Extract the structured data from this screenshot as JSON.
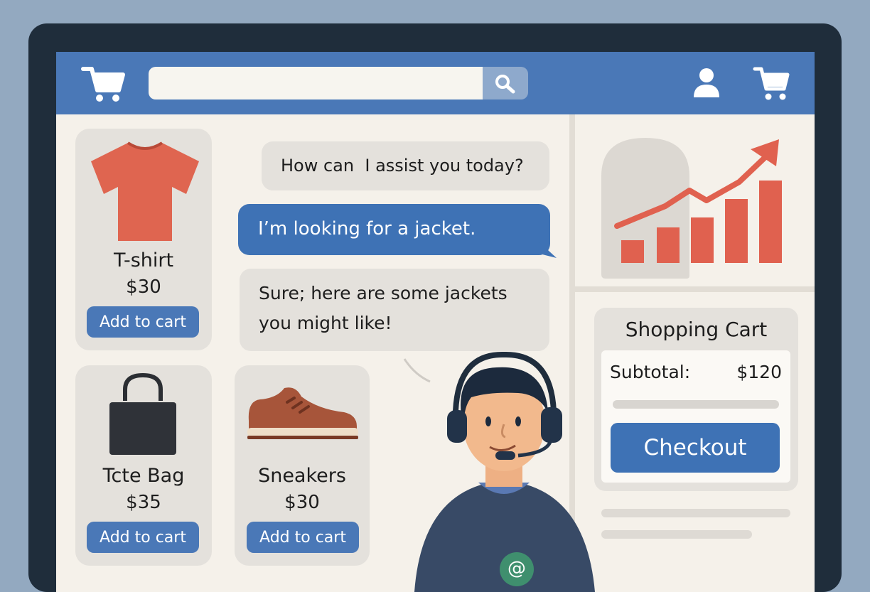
{
  "header": {
    "search": {
      "value": "",
      "placeholder": ""
    },
    "icons": [
      "cart-logo-icon",
      "search-icon",
      "user-icon",
      "cart-icon"
    ]
  },
  "products": [
    {
      "name": "T-shirt",
      "price": "$30",
      "button": "Add to cart",
      "icon": "t-shirt-icon"
    },
    {
      "name": "Tcte Bag",
      "price": "$35",
      "button": "Add to cart",
      "icon": "tote-bag-icon"
    },
    {
      "name": "Sneakers",
      "price": "$30",
      "button": "Add to cart",
      "icon": "sneaker-icon"
    }
  ],
  "chat": {
    "messages": [
      {
        "sender": "agent",
        "text": "How can  I assist you today?"
      },
      {
        "sender": "user",
        "text": "I’m looking for a jacket."
      },
      {
        "sender": "agent",
        "line1": "Sure; here are some jackets",
        "line2": "you might like!"
      }
    ],
    "agent_badge": "@"
  },
  "cart": {
    "title": "Shopping Cart",
    "subtotal_label": "Subtotal:",
    "subtotal_value": "$120",
    "checkout_label": "Checkout"
  },
  "colors": {
    "brand_blue": "#4a78b7",
    "chart_red": "#e0614f",
    "badge_green": "#3f8f6e",
    "screen_bg": "#f5f1ea"
  }
}
